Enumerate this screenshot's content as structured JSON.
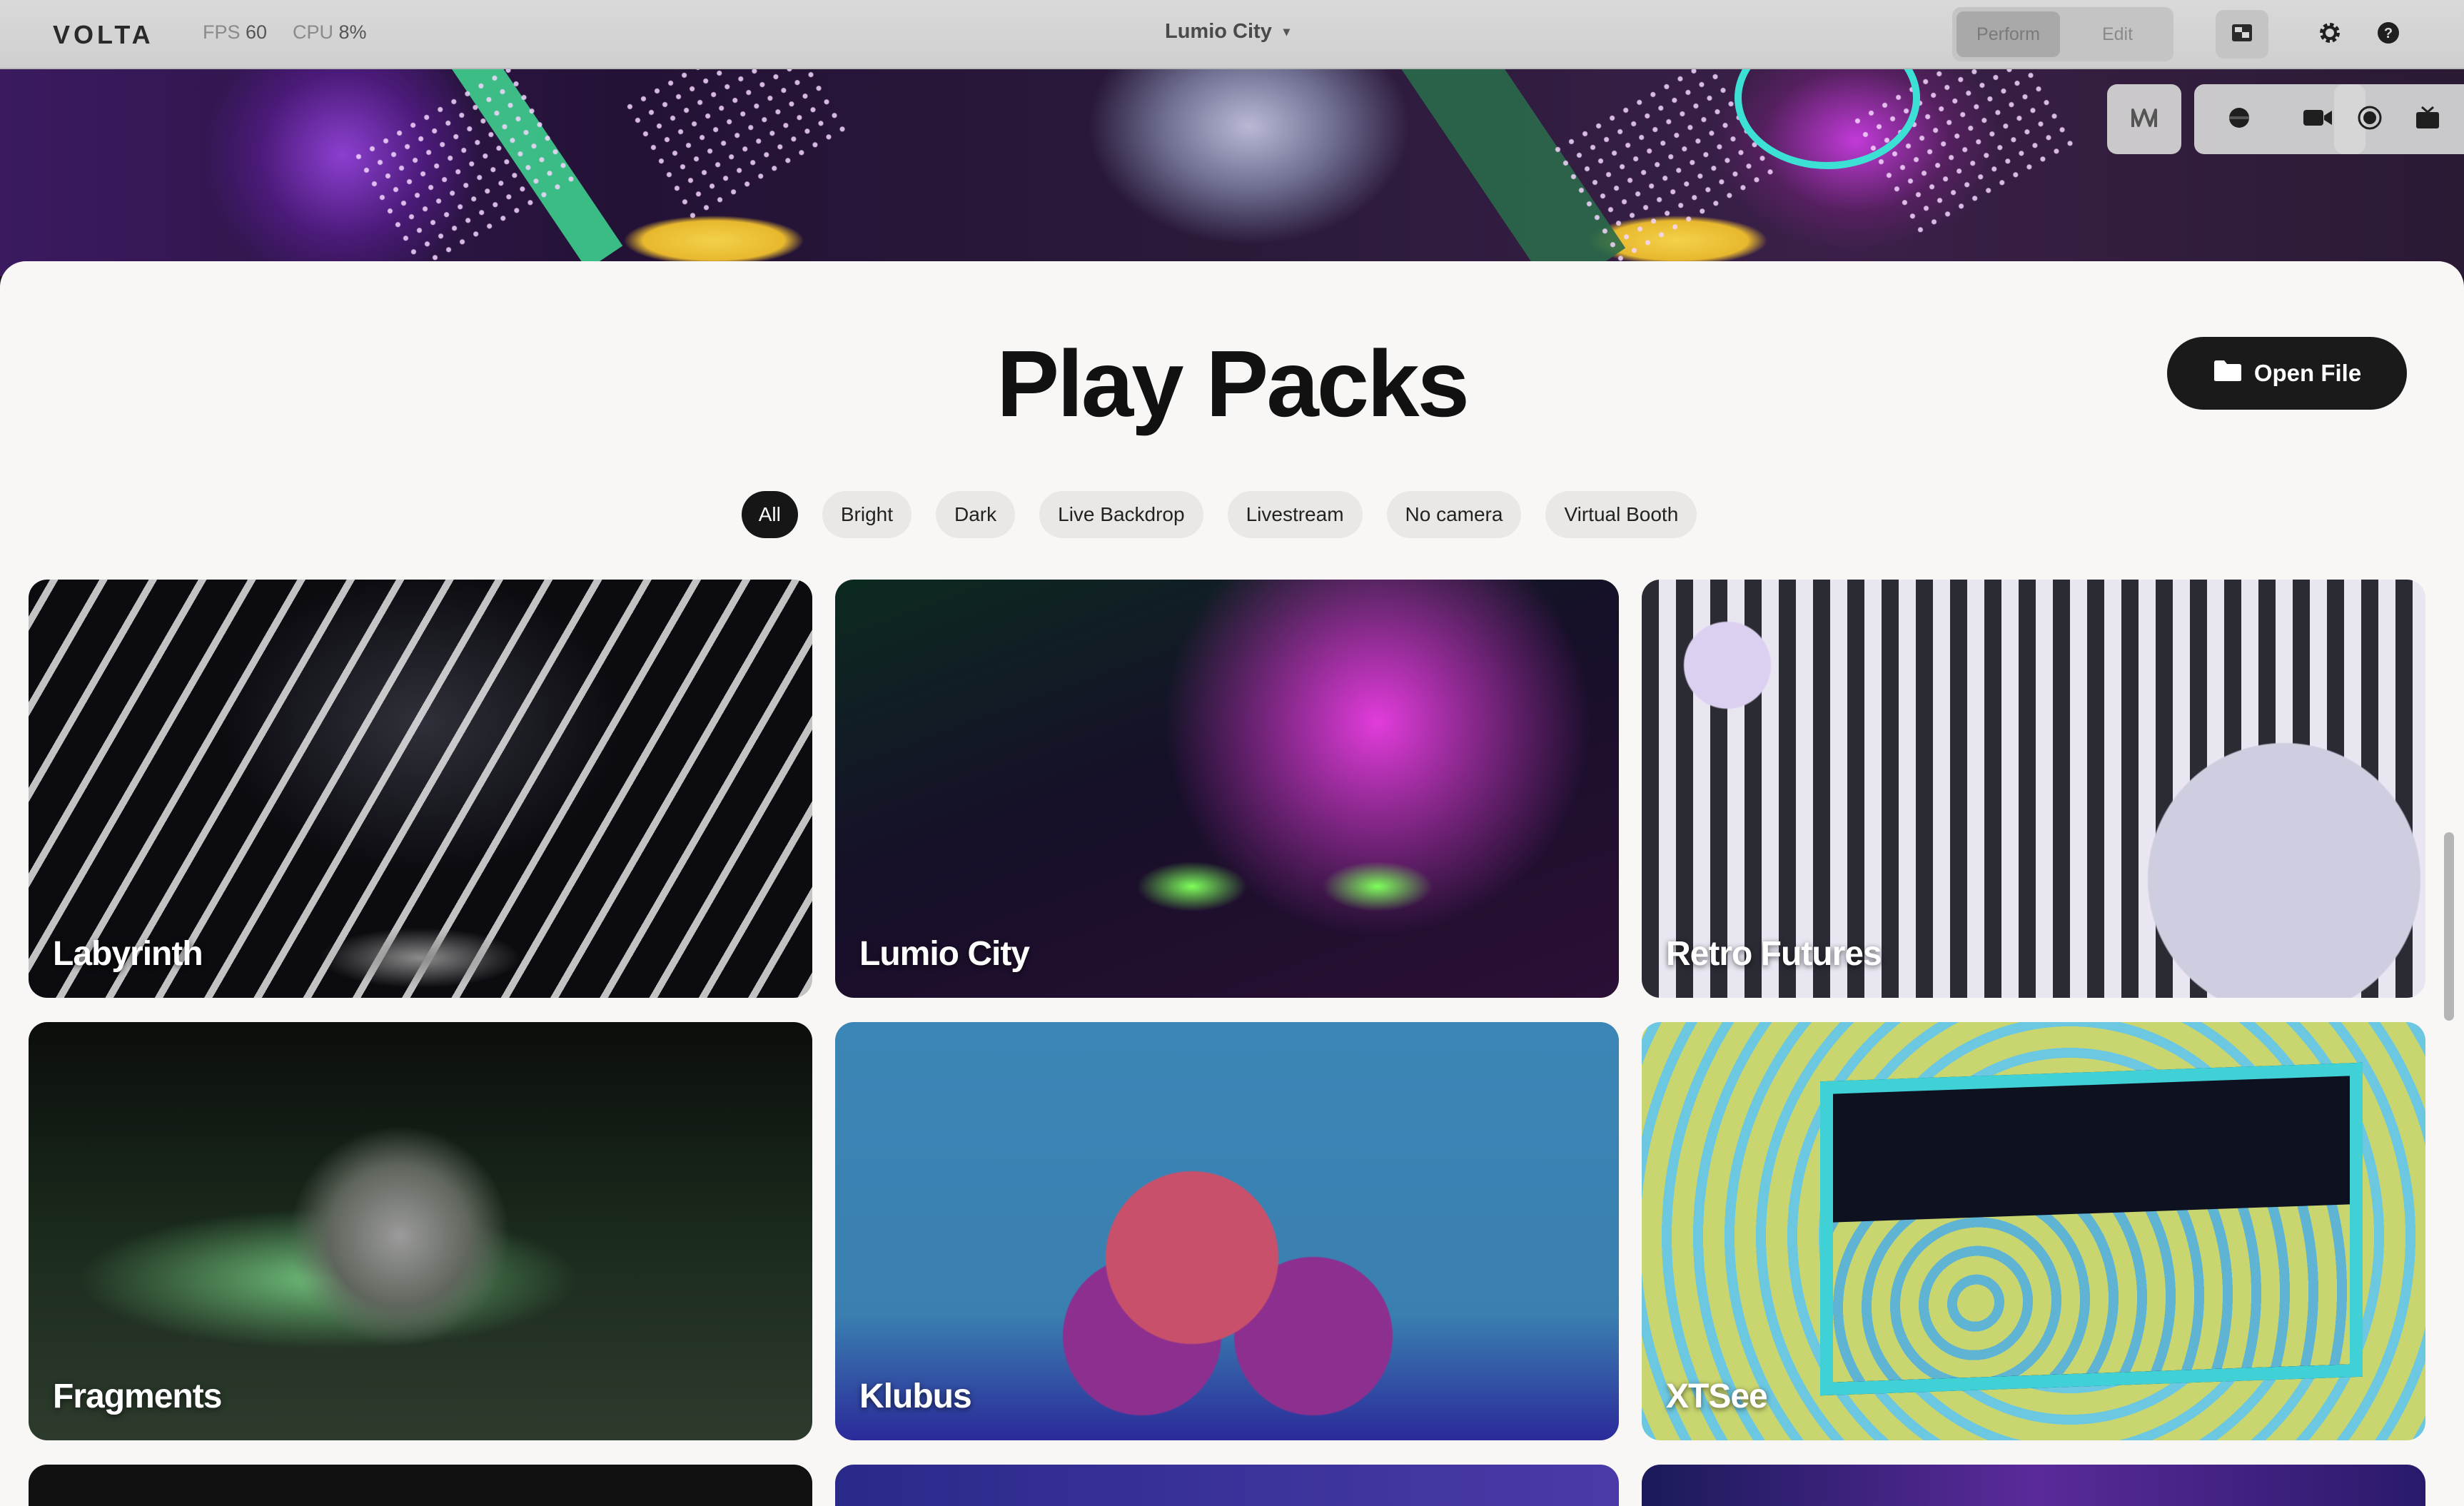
{
  "app": {
    "logo": "VOLTA",
    "fps_label": "FPS",
    "fps_value": "60",
    "cpu_label": "CPU",
    "cpu_value": "8%",
    "scene": "Lumio City",
    "modes": [
      "Perform",
      "Edit"
    ],
    "active_mode": "Perform"
  },
  "page": {
    "title": "Play Packs",
    "open_file_label": "Open File"
  },
  "filters": {
    "active": "All",
    "items": [
      "All",
      "Bright",
      "Dark",
      "Live Backdrop",
      "Livestream",
      "No camera",
      "Virtual Booth"
    ]
  },
  "packs": [
    {
      "name": "Labyrinth"
    },
    {
      "name": "Lumio City"
    },
    {
      "name": "Retro Futures"
    },
    {
      "name": "Fragments"
    },
    {
      "name": "Klubus"
    },
    {
      "name": "XTSee"
    }
  ],
  "colors": {
    "accent_dark": "#161616",
    "panel_bg": "#f8f7f5",
    "chip_bg": "#e9e8e5"
  },
  "icons": [
    "display-icon",
    "gear-icon",
    "help-icon",
    "wave-icon",
    "circle-icon",
    "camera-icon",
    "record-icon",
    "tv-icon",
    "folder-icon",
    "chevron-down-icon"
  ]
}
